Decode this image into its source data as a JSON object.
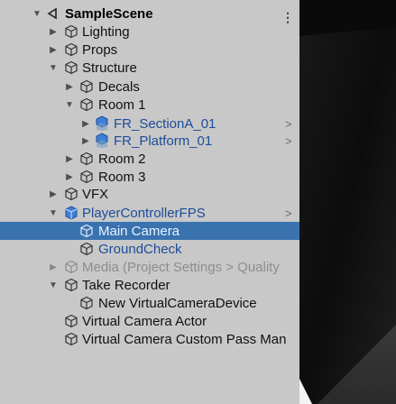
{
  "hierarchy": {
    "scene_name": "SampleScene",
    "items": [
      {
        "label": "Lighting"
      },
      {
        "label": "Props"
      },
      {
        "label": "Structure"
      },
      {
        "label": "Decals"
      },
      {
        "label": "Room 1"
      },
      {
        "label": "FR_SectionA_01"
      },
      {
        "label": "FR_Platform_01"
      },
      {
        "label": "Room 2"
      },
      {
        "label": "Room 3"
      },
      {
        "label": "VFX"
      },
      {
        "label": "PlayerControllerFPS"
      },
      {
        "label": "Main Camera"
      },
      {
        "label": "GroundCheck"
      },
      {
        "label": "Media (Project Settings > Quality"
      },
      {
        "label": "Take Recorder"
      },
      {
        "label": "New VirtualCameraDevice"
      },
      {
        "label": "Virtual Camera Actor"
      },
      {
        "label": "Virtual Camera Custom Pass Man"
      }
    ]
  },
  "icons": {
    "scene": "unity-scene-icon",
    "gameobject": "cube-icon",
    "prefab": "prefab-cube-icon",
    "expand": "triangle-down-icon",
    "collapse": "triangle-right-icon",
    "open_prefab": "chevron-right-icon",
    "menu": "kebab-menu-icon"
  },
  "colors": {
    "panel": "#c8c8c8",
    "selected": "#3a72b0",
    "prefab_text": "#1d4d9a",
    "disabled_text": "#8d8d8d"
  }
}
